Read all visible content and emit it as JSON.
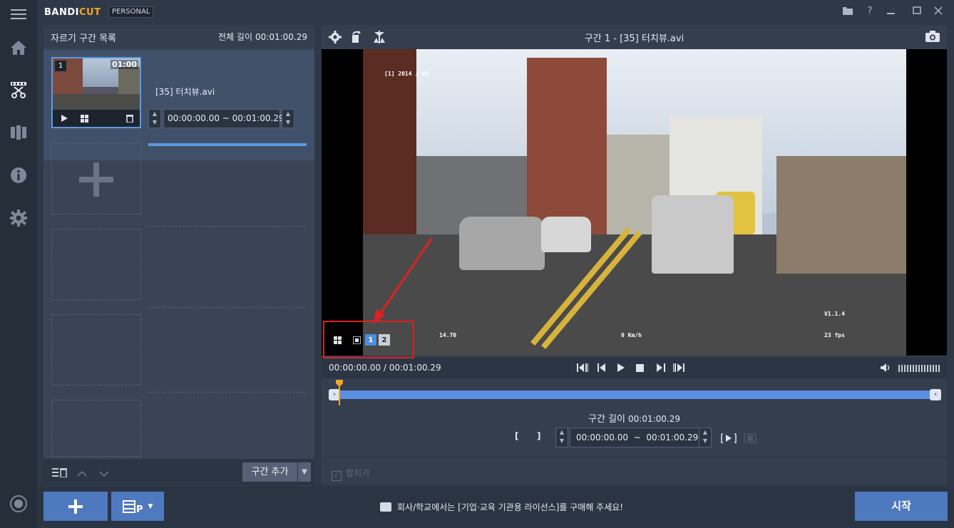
{
  "app": {
    "brand_main": "BANDI",
    "brand_accent": "CUT",
    "edition": "PERSONAL",
    "colors": {
      "accent": "#5b9be6",
      "brand_accent": "#f5a623",
      "highlight": "#e02020",
      "start_button": "#4f79bf"
    }
  },
  "window_controls": [
    "folder-icon",
    "help-icon",
    "minimize-icon",
    "maximize-icon",
    "close-icon"
  ],
  "rail": {
    "items": [
      "menu-icon",
      "home-icon",
      "cut-icon",
      "film-icon",
      "info-icon",
      "settings-icon"
    ],
    "bottom": "record-icon"
  },
  "segment_list": {
    "title": "자르기 구간 목록",
    "total_label": "전체 길이",
    "total_value": "00:01:00.29",
    "items": [
      {
        "index": "1",
        "duration": "01:00",
        "filename": "[35] 터치뷰.avi",
        "range": "00:00:00.00 ~ 00:01:00.29"
      }
    ],
    "add_segment_button": "구간 추가"
  },
  "preview": {
    "title": "구간 1 - [35] 터치뷰.avi",
    "osd": {
      "top_left": "[1] 2014 / 02",
      "speed": "0 Km/h",
      "version": "V1.1.4",
      "fps": "23 fps",
      "value_left": "14.70"
    },
    "view_mode_buttons": [
      "1",
      "2"
    ],
    "current_time": "00:00:00.00",
    "total_time": "00:01:00.29",
    "time_separator": "/",
    "segment_length_label": "구간 길이",
    "segment_length_value": "00:01:00.29",
    "range_start": "00:00:00.00",
    "range_end": "00:01:00.29",
    "range_separator": "~",
    "bracket_start": "[",
    "bracket_end": "]",
    "merge_label": "합치기",
    "merge_checked": true
  },
  "bottom_bar": {
    "notice": "회사/학교에서는 [기업·교육 기관용 라이선스]를 구매해 주세요!",
    "start_button": "시작"
  }
}
